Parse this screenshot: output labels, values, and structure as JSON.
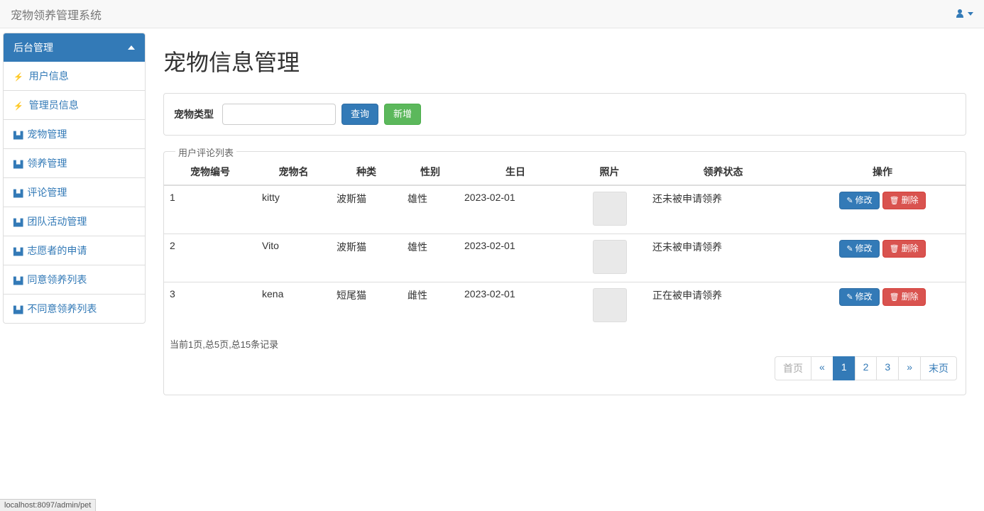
{
  "app": {
    "title": "宠物领养管理系统",
    "status_url": "localhost:8097/admin/pet"
  },
  "sidebar": {
    "heading": "后台管理",
    "items": [
      {
        "label": "用户信息",
        "icon": "bolt"
      },
      {
        "label": "管理员信息",
        "icon": "bolt"
      },
      {
        "label": "宠物管理",
        "icon": "sitemap"
      },
      {
        "label": "领养管理",
        "icon": "sitemap"
      },
      {
        "label": "评论管理",
        "icon": "sitemap"
      },
      {
        "label": "团队活动管理",
        "icon": "sitemap"
      },
      {
        "label": "志愿者的申请",
        "icon": "sitemap"
      },
      {
        "label": "同意领养列表",
        "icon": "sitemap"
      },
      {
        "label": "不同意领养列表",
        "icon": "sitemap"
      }
    ]
  },
  "page": {
    "title": "宠物信息管理",
    "filter": {
      "label": "宠物类型",
      "value": "",
      "search_btn": "查询",
      "add_btn": "新增"
    },
    "table": {
      "legend": "用户评论列表",
      "headers": {
        "id": "宠物编号",
        "name": "宠物名",
        "breed": "种类",
        "gender": "性别",
        "birthday": "生日",
        "photo": "照片",
        "status": "领养状态",
        "action": "操作"
      },
      "rows": [
        {
          "id": "1",
          "name": "kitty",
          "breed": "波斯猫",
          "gender": "雄性",
          "birthday": "2023-02-01",
          "status": "还未被申请领养"
        },
        {
          "id": "2",
          "name": "Vito",
          "breed": "波斯猫",
          "gender": "雄性",
          "birthday": "2023-02-01",
          "status": "还未被申请领养"
        },
        {
          "id": "3",
          "name": "kena",
          "breed": "短尾猫",
          "gender": "雌性",
          "birthday": "2023-02-01",
          "status": "正在被申请领养"
        }
      ],
      "action_edit": "修改",
      "action_delete": "删除"
    },
    "pagination": {
      "summary": "当前1页,总5页,总15条记录",
      "first": "首页",
      "prev": "«",
      "pages": [
        "1",
        "2",
        "3"
      ],
      "current": "1",
      "next": "»",
      "last": "末页"
    }
  }
}
